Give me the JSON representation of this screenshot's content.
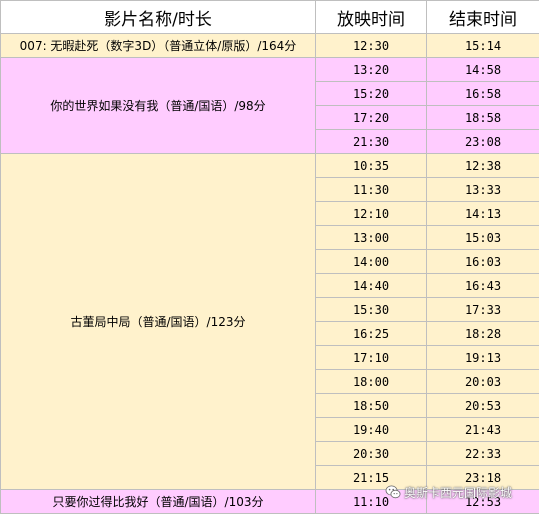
{
  "header": {
    "movie": "影片名称/时长",
    "start": "放映时间",
    "end": "结束时间"
  },
  "groups": [
    {
      "movie": "007: 无暇赴死（数字3D）（普通立体/原版）/164分",
      "shows": [
        {
          "start": "12:30",
          "end": "15:14"
        }
      ]
    },
    {
      "movie": "你的世界如果没有我（普通/国语）/98分",
      "shows": [
        {
          "start": "13:20",
          "end": "14:58"
        },
        {
          "start": "15:20",
          "end": "16:58"
        },
        {
          "start": "17:20",
          "end": "18:58"
        },
        {
          "start": "21:30",
          "end": "23:08"
        }
      ]
    },
    {
      "movie": "古董局中局（普通/国语）/123分",
      "shows": [
        {
          "start": "10:35",
          "end": "12:38"
        },
        {
          "start": "11:30",
          "end": "13:33"
        },
        {
          "start": "12:10",
          "end": "14:13"
        },
        {
          "start": "13:00",
          "end": "15:03"
        },
        {
          "start": "14:00",
          "end": "16:03"
        },
        {
          "start": "14:40",
          "end": "16:43"
        },
        {
          "start": "15:30",
          "end": "17:33"
        },
        {
          "start": "16:25",
          "end": "18:28"
        },
        {
          "start": "17:10",
          "end": "19:13"
        },
        {
          "start": "18:00",
          "end": "20:03"
        },
        {
          "start": "18:50",
          "end": "20:53"
        },
        {
          "start": "19:40",
          "end": "21:43"
        },
        {
          "start": "20:30",
          "end": "22:33"
        },
        {
          "start": "21:15",
          "end": "23:18"
        }
      ]
    },
    {
      "movie": "只要你过得比我好（普通/国语）/103分",
      "shows": [
        {
          "start": "11:10",
          "end": "12:53"
        }
      ]
    }
  ],
  "colors": {
    "row_yellow": "#fff2cc",
    "row_pink": "#ffccff",
    "grid": "#bfbfbf"
  },
  "watermark": {
    "icon": "wechat-icon",
    "text": "奥斯卡西元国际影城"
  }
}
